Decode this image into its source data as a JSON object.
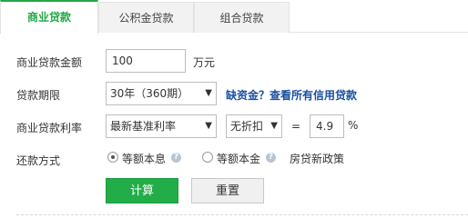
{
  "tabs": [
    {
      "label": "商业贷款",
      "active": true
    },
    {
      "label": "公积金贷款",
      "active": false
    },
    {
      "label": "组合贷款",
      "active": false
    }
  ],
  "form": {
    "amount": {
      "label": "商业贷款金额",
      "value": "100",
      "unit": "万元"
    },
    "term": {
      "label": "贷款期限",
      "selected": "30年（360期）",
      "link": "缺资金？查看所有信用贷款"
    },
    "rate": {
      "label": "商业贷款利率",
      "base_selected": "最新基准利率",
      "discount_selected": "无折扣",
      "equals": "=",
      "value": "4.9",
      "unit": "%"
    },
    "method": {
      "label": "还款方式",
      "options": [
        {
          "label": "等额本息",
          "checked": true
        },
        {
          "label": "等额本金",
          "checked": false
        }
      ],
      "policy_link": "房贷新政策",
      "help": "?"
    }
  },
  "buttons": {
    "calculate": "计算",
    "reset": "重置"
  },
  "colors": {
    "accent": "#22ad48",
    "link": "#1a4fa0"
  }
}
